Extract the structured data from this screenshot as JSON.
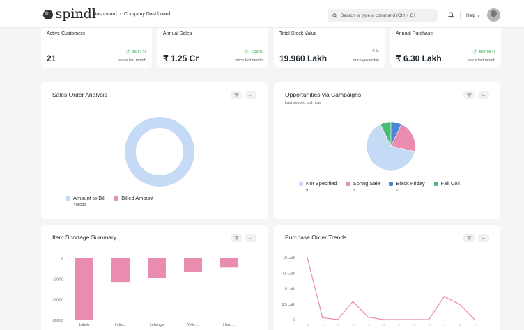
{
  "nav": {
    "logo_text": "spindl",
    "breadcrumbs": [
      "Dashboard",
      "Company Dashboard"
    ],
    "search_placeholder": "Search or type a command (Ctrl + G)",
    "help_label": "Help"
  },
  "number_cards": [
    {
      "label": "Active Customers",
      "value": "21",
      "change": "16.67 %",
      "since": "since last month",
      "trend": "up"
    },
    {
      "label": "Annual Sales",
      "value": "₹ 1.25 Cr",
      "change": "4.03 %",
      "since": "since last month",
      "trend": "up"
    },
    {
      "label": "Total Stock Value",
      "value": "19.960 Lakh",
      "change": "0 %",
      "since": "since yesterday",
      "trend": "neutral"
    },
    {
      "label": "Annual Purchase",
      "value": "₹ 6.30 Lakh",
      "change": "597.05 %",
      "since": "since last month",
      "trend": "up"
    }
  ],
  "card_menu_label": "...",
  "sales_order": {
    "title": "Sales Order Analysis",
    "chart_data": {
      "type": "pie",
      "variant": "donut",
      "labels": [
        "Amount to Bill",
        "Billed Amount"
      ],
      "values": [
        475000,
        0
      ],
      "colors": [
        "#c5dbf5",
        "#ea8bb0"
      ],
      "legend_values": [
        "475000",
        ""
      ]
    }
  },
  "opportunities": {
    "title": "Opportunities via Campaigns",
    "subtitle": "Last synced just now",
    "chart_data": {
      "type": "pie",
      "labels": [
        "Not Specified",
        "Spring Sale",
        "Black Friday",
        "Fall Coll"
      ],
      "values": [
        9,
        3,
        1,
        1
      ],
      "colors": [
        "#c5dbf5",
        "#ea8bb0",
        "#4d86d6",
        "#48bb74"
      ]
    }
  },
  "item_shortage": {
    "title": "Item Shortage Summary",
    "chart_data": {
      "type": "bar",
      "categories": [
        "Labels",
        "India ...",
        "Lehenga",
        "Yello ...",
        "Hand ..."
      ],
      "values": [
        -300,
        -115,
        -95,
        -65,
        -45
      ],
      "ylim": [
        -300,
        0
      ],
      "yticks": [
        "0",
        "-100.00",
        "-200.00",
        "-300.00"
      ],
      "color": "#ea8bb0"
    }
  },
  "purchase_trends": {
    "title": "Purchase Order Trends",
    "chart_data": {
      "type": "line",
      "x": [
        "1",
        "2",
        "3",
        "4",
        "5",
        "6",
        "7",
        "8",
        "9",
        "10",
        "11",
        "12"
      ],
      "values": [
        1000000,
        30000,
        0,
        290000,
        40000,
        0,
        0,
        0,
        0,
        370000,
        250000,
        0
      ],
      "ylim": [
        0,
        1000000
      ],
      "yticks": [
        "0",
        "2.5 Lakh",
        "5 Lakh",
        "7.5 Lakh",
        "10 Lakh"
      ],
      "color": "#ea8bb0"
    }
  }
}
